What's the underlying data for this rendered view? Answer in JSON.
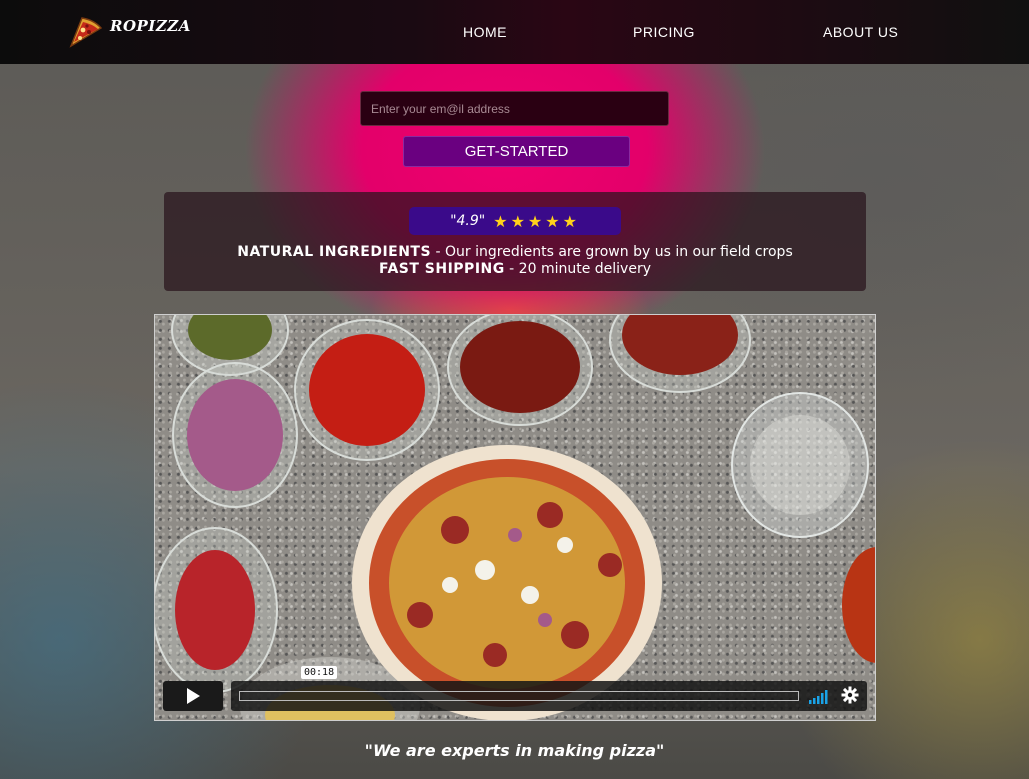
{
  "header": {
    "brand": "ROPIZZA",
    "nav": [
      {
        "label": "HOME"
      },
      {
        "label": "PRICING"
      },
      {
        "label": "ABOUT US"
      }
    ]
  },
  "signup": {
    "email_placeholder": "Enter your em@il address",
    "email_value": "",
    "button_label": "GET-STARTED"
  },
  "rating": {
    "score": "\"4.9\"",
    "stars": 5,
    "stars_text": "★★★★★"
  },
  "features": [
    {
      "title": "NATURAL INGREDIENTS",
      "text": " - Our ingredients are grown by us in our field crops"
    },
    {
      "title": "FAST SHIPPING",
      "text": " - 20 minute delivery"
    }
  ],
  "video": {
    "time": "00:18",
    "progress": 0
  },
  "tagline": "\"We are experts in making pizza\"",
  "colors": {
    "accent_pink": "#e3006a",
    "button_purple": "#6a0080",
    "rating_bg": "#3a0a8a",
    "star": "#ffd21a",
    "volume": "#1aa3e8"
  }
}
